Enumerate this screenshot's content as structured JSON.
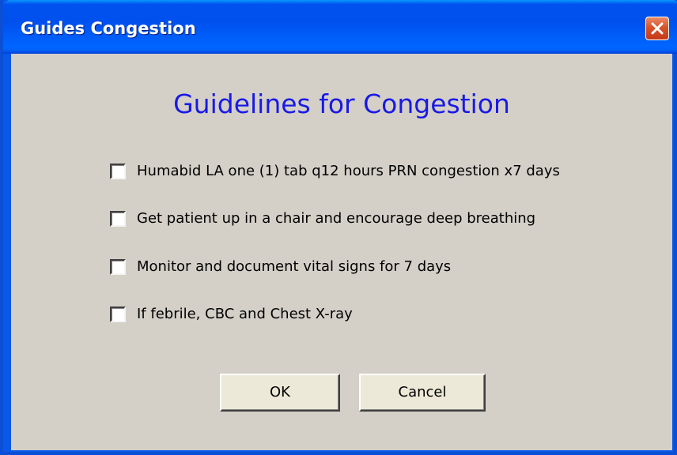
{
  "window": {
    "title": "Guides Congestion"
  },
  "heading": "Guidelines for Congestion",
  "options": [
    {
      "label": "Humabid LA one (1) tab q12 hours PRN congestion x7 days",
      "checked": false
    },
    {
      "label": "Get patient up in a chair and encourage deep breathing",
      "checked": false
    },
    {
      "label": "Monitor and document vital signs for 7 days",
      "checked": false
    },
    {
      "label": "If febrile, CBC and Chest X-ray",
      "checked": false
    }
  ],
  "buttons": {
    "ok_label": "OK",
    "cancel_label": "Cancel"
  },
  "icons": {
    "close": "close-icon"
  },
  "colors": {
    "heading": "#1919e6",
    "titlebar": "#0053ee",
    "dialog_bg": "#d4d0c8",
    "close": "#d9532a"
  }
}
